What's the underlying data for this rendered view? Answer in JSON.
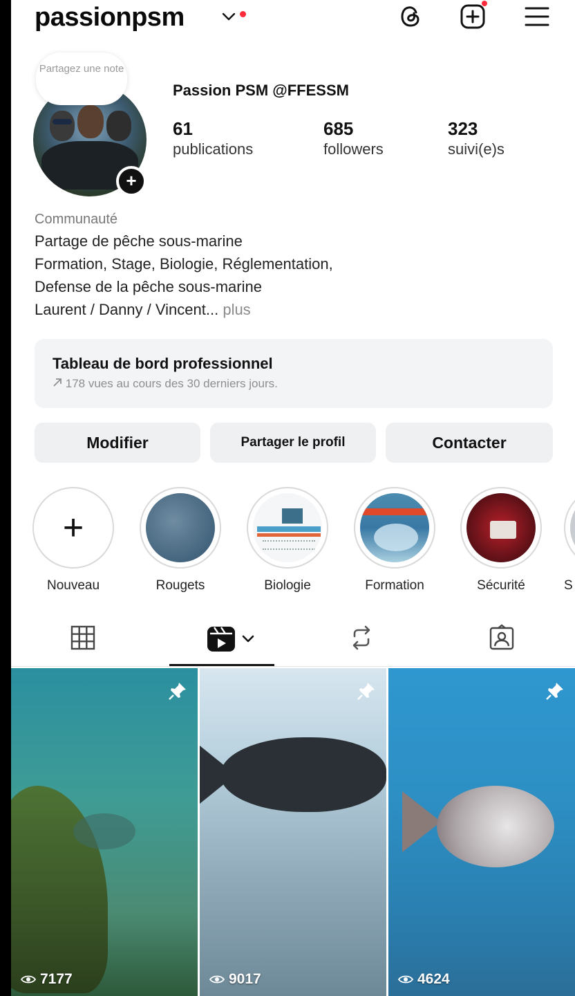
{
  "header": {
    "username": "passionpsm"
  },
  "profile": {
    "note": "Partagez une note",
    "display_name": "Passion PSM @FFESSM",
    "stats": {
      "publications": {
        "value": "61",
        "label": "publications"
      },
      "followers": {
        "value": "685",
        "label": "followers"
      },
      "following": {
        "value": "323",
        "label": "suivi(e)s"
      }
    }
  },
  "bio": {
    "category": "Communauté",
    "lines": [
      "Partage de pêche sous-marine",
      "Formation, Stage, Biologie, Réglementation,",
      "Defense de la pêche sous-marine",
      "Laurent / Danny / Vincent..."
    ],
    "more": "plus"
  },
  "dashboard": {
    "title": "Tableau de bord professionnel",
    "subtitle": "178 vues au cours des 30 derniers jours."
  },
  "actions": {
    "edit": "Modifier",
    "share": "Partager le profil",
    "contact": "Contacter"
  },
  "highlights": [
    {
      "label": "Nouveau"
    },
    {
      "label": "Rougets"
    },
    {
      "label": "Biologie"
    },
    {
      "label": "Formation"
    },
    {
      "label": "Sécurité"
    },
    {
      "label": "S"
    }
  ],
  "grid": [
    {
      "views": "7177",
      "pinned": true
    },
    {
      "views": "9017",
      "pinned": true
    },
    {
      "views": "4624",
      "pinned": true
    }
  ],
  "colors": {
    "notification_dot": "#ff2b3a",
    "button_bg": "#eff0f2",
    "dashboard_bg": "#f3f4f6"
  },
  "icons": {
    "header": [
      "threads-icon",
      "create-icon",
      "menu-icon"
    ],
    "tabs": [
      "grid-icon",
      "reels-icon",
      "reposts-icon",
      "tagged-icon"
    ]
  }
}
